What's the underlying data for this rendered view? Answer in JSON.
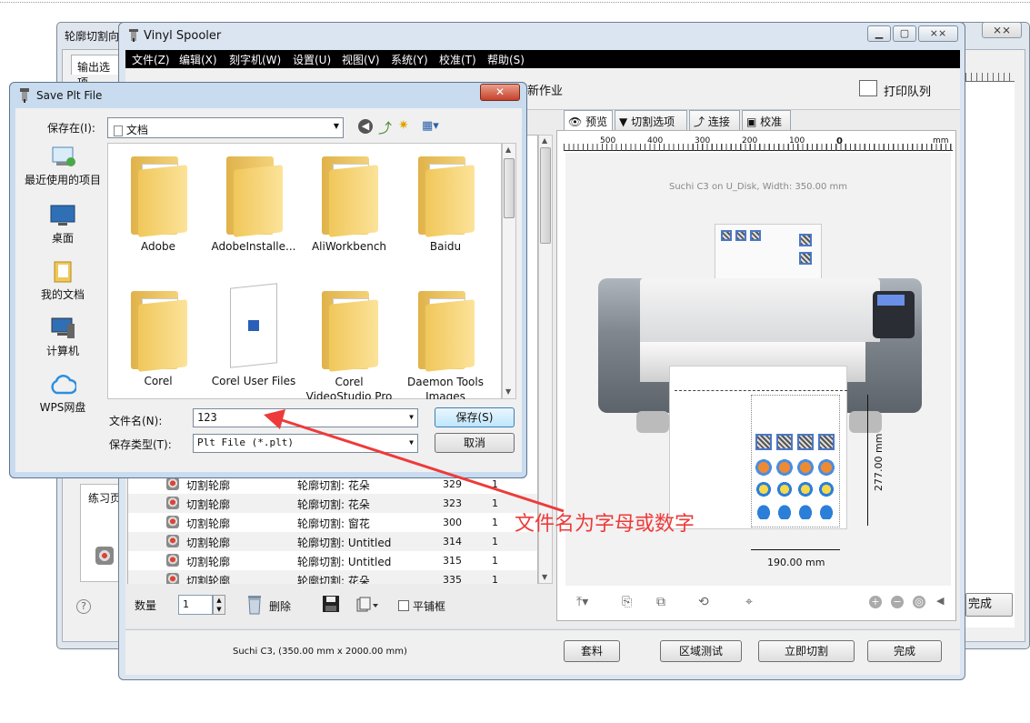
{
  "background_window": {
    "title": "轮廓切割向",
    "tab": "输出选项",
    "close_glyph": "⨯⨯",
    "side_panel_label": "练习页",
    "done_label": "完成",
    "help_glyph": "?"
  },
  "spooler": {
    "title": "Vinyl Spooler",
    "menu": [
      "文件(Z)",
      "编辑(X)",
      "刻字机(W)",
      "设置(U)",
      "视图(V)",
      "系统(Y)",
      "校准(T)",
      "帮助(S)"
    ],
    "toolbar": {
      "new_job": "新作业",
      "print_queue": "打印队列"
    },
    "tabs": [
      "预览",
      "切割选项",
      "连接",
      "校准"
    ],
    "ruler_labels": [
      "500",
      "400",
      "300",
      "200",
      "100",
      "0",
      "mm"
    ],
    "preview_caption": "Suchi C3 on U_Disk,  Width: 350.00 mm",
    "dim_height": "277.00 mm",
    "dim_width": "190.00 mm",
    "jobs": [
      {
        "name": "切割轮廓",
        "desc": "轮廓切割: 花朵",
        "id": "329",
        "count": "1"
      },
      {
        "name": "切割轮廓",
        "desc": "轮廓切割: 花朵",
        "id": "323",
        "count": "1"
      },
      {
        "name": "切割轮廓",
        "desc": "轮廓切割: 窗花",
        "id": "300",
        "count": "1"
      },
      {
        "name": "切割轮廓",
        "desc": "轮廓切割: Untitled",
        "id": "314",
        "count": "1"
      },
      {
        "name": "切割轮廓",
        "desc": "轮廓切割: Untitled",
        "id": "315",
        "count": "1"
      },
      {
        "name": "切割轮廓",
        "desc": "轮廓切割: 花朵",
        "id": "335",
        "count": "1"
      }
    ],
    "quantity_label": "数量",
    "quantity_value": "1",
    "delete_label": "删除",
    "tile_label": "平铺框",
    "status": "Suchi C3,  (350.00 mm x 2000.00 mm)",
    "buttons": {
      "nest": "套料",
      "area_test": "区域测试",
      "cut_now": "立即切割",
      "done": "完成"
    }
  },
  "save_dialog": {
    "title": "Save Plt File",
    "close_glyph": "✕",
    "save_in_label": "保存在(I):",
    "save_in_value": "文档",
    "places": [
      "最近使用的项目",
      "桌面",
      "我的文档",
      "计算机",
      "WPS网盘"
    ],
    "folders": [
      "Adobe",
      "AdobeInstalle...",
      "AliWorkbench",
      "Baidu",
      "Corel",
      "Corel User Files",
      "Corel VideoStudio Pro",
      "Daemon Tools Images"
    ],
    "file_name_label": "文件名(N):",
    "file_name_value": "123",
    "file_type_label": "保存类型(T):",
    "file_type_value": "Plt File (*.plt)",
    "save_button": "保存(S)",
    "cancel_button": "取消"
  },
  "annotation": {
    "text": "文件名为字母或数字",
    "color": "#ee3a3a"
  }
}
